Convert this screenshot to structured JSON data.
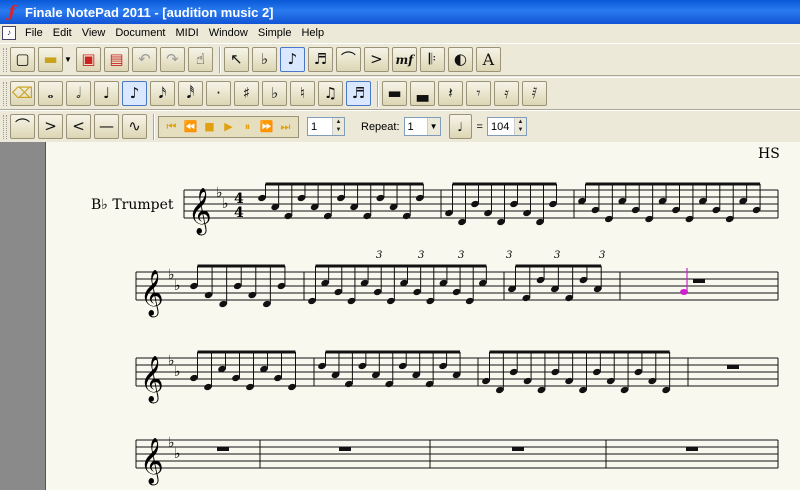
{
  "window": {
    "title": "Finale NotePad 2011 - [audition music 2]",
    "app_icon": "finale-f-icon"
  },
  "menu": [
    "File",
    "Edit",
    "View",
    "Document",
    "MIDI",
    "Window",
    "Simple",
    "Help"
  ],
  "toolbar1": {
    "buttons": [
      {
        "name": "new-document",
        "icon": "new-file-icon"
      },
      {
        "name": "open",
        "icon": "folder-icon"
      },
      {
        "name": "save",
        "icon": "floppy-icon"
      },
      {
        "name": "print",
        "icon": "printer-icon"
      },
      {
        "name": "undo",
        "icon": "undo-icon"
      },
      {
        "name": "redo",
        "icon": "redo-icon"
      },
      {
        "name": "hand-grabber",
        "icon": "hand-icon"
      },
      {
        "name": "selection",
        "icon": "arrow-select-icon"
      },
      {
        "name": "key-signature",
        "icon": "key-sig-icon"
      },
      {
        "name": "simple-entry",
        "icon": "eighth-note-icon"
      },
      {
        "name": "tuplet",
        "icon": "tuplet-icon"
      },
      {
        "name": "smart-shape",
        "icon": "slur-icon"
      },
      {
        "name": "articulation",
        "icon": "articulation-icon"
      },
      {
        "name": "expression",
        "label": "mf"
      },
      {
        "name": "repeat",
        "icon": "repeat-icon"
      },
      {
        "name": "chord",
        "icon": "chord-icon"
      },
      {
        "name": "text",
        "label": "A"
      }
    ]
  },
  "toolbar2": {
    "buttons": [
      "eraser",
      "whole-note",
      "half-note",
      "quarter-note",
      "eighth-note",
      "sixteenth-note",
      "thirtysecond-note",
      "dot",
      "sharp",
      "flat",
      "natural",
      "tie",
      "tuplet-entry",
      "whole-rest",
      "half-rest",
      "quarter-rest",
      "eighth-rest",
      "sixteenth-rest",
      "thirtysecond-rest"
    ],
    "active": "eighth-note"
  },
  "toolbar3": {
    "shape_buttons": [
      "slur",
      "decrescendo",
      "crescendo",
      "line",
      "bend"
    ],
    "measure_value": "1",
    "repeat_label": "Repeat:",
    "repeat_value": "1",
    "tempo_equals": "=",
    "tempo_value": "104"
  },
  "score": {
    "header_right": "HS",
    "instrument": "B♭ Trumpet",
    "time_signature": [
      "4",
      "4"
    ],
    "tuplet_label": "3",
    "highlight_color": "#cc22cc"
  }
}
